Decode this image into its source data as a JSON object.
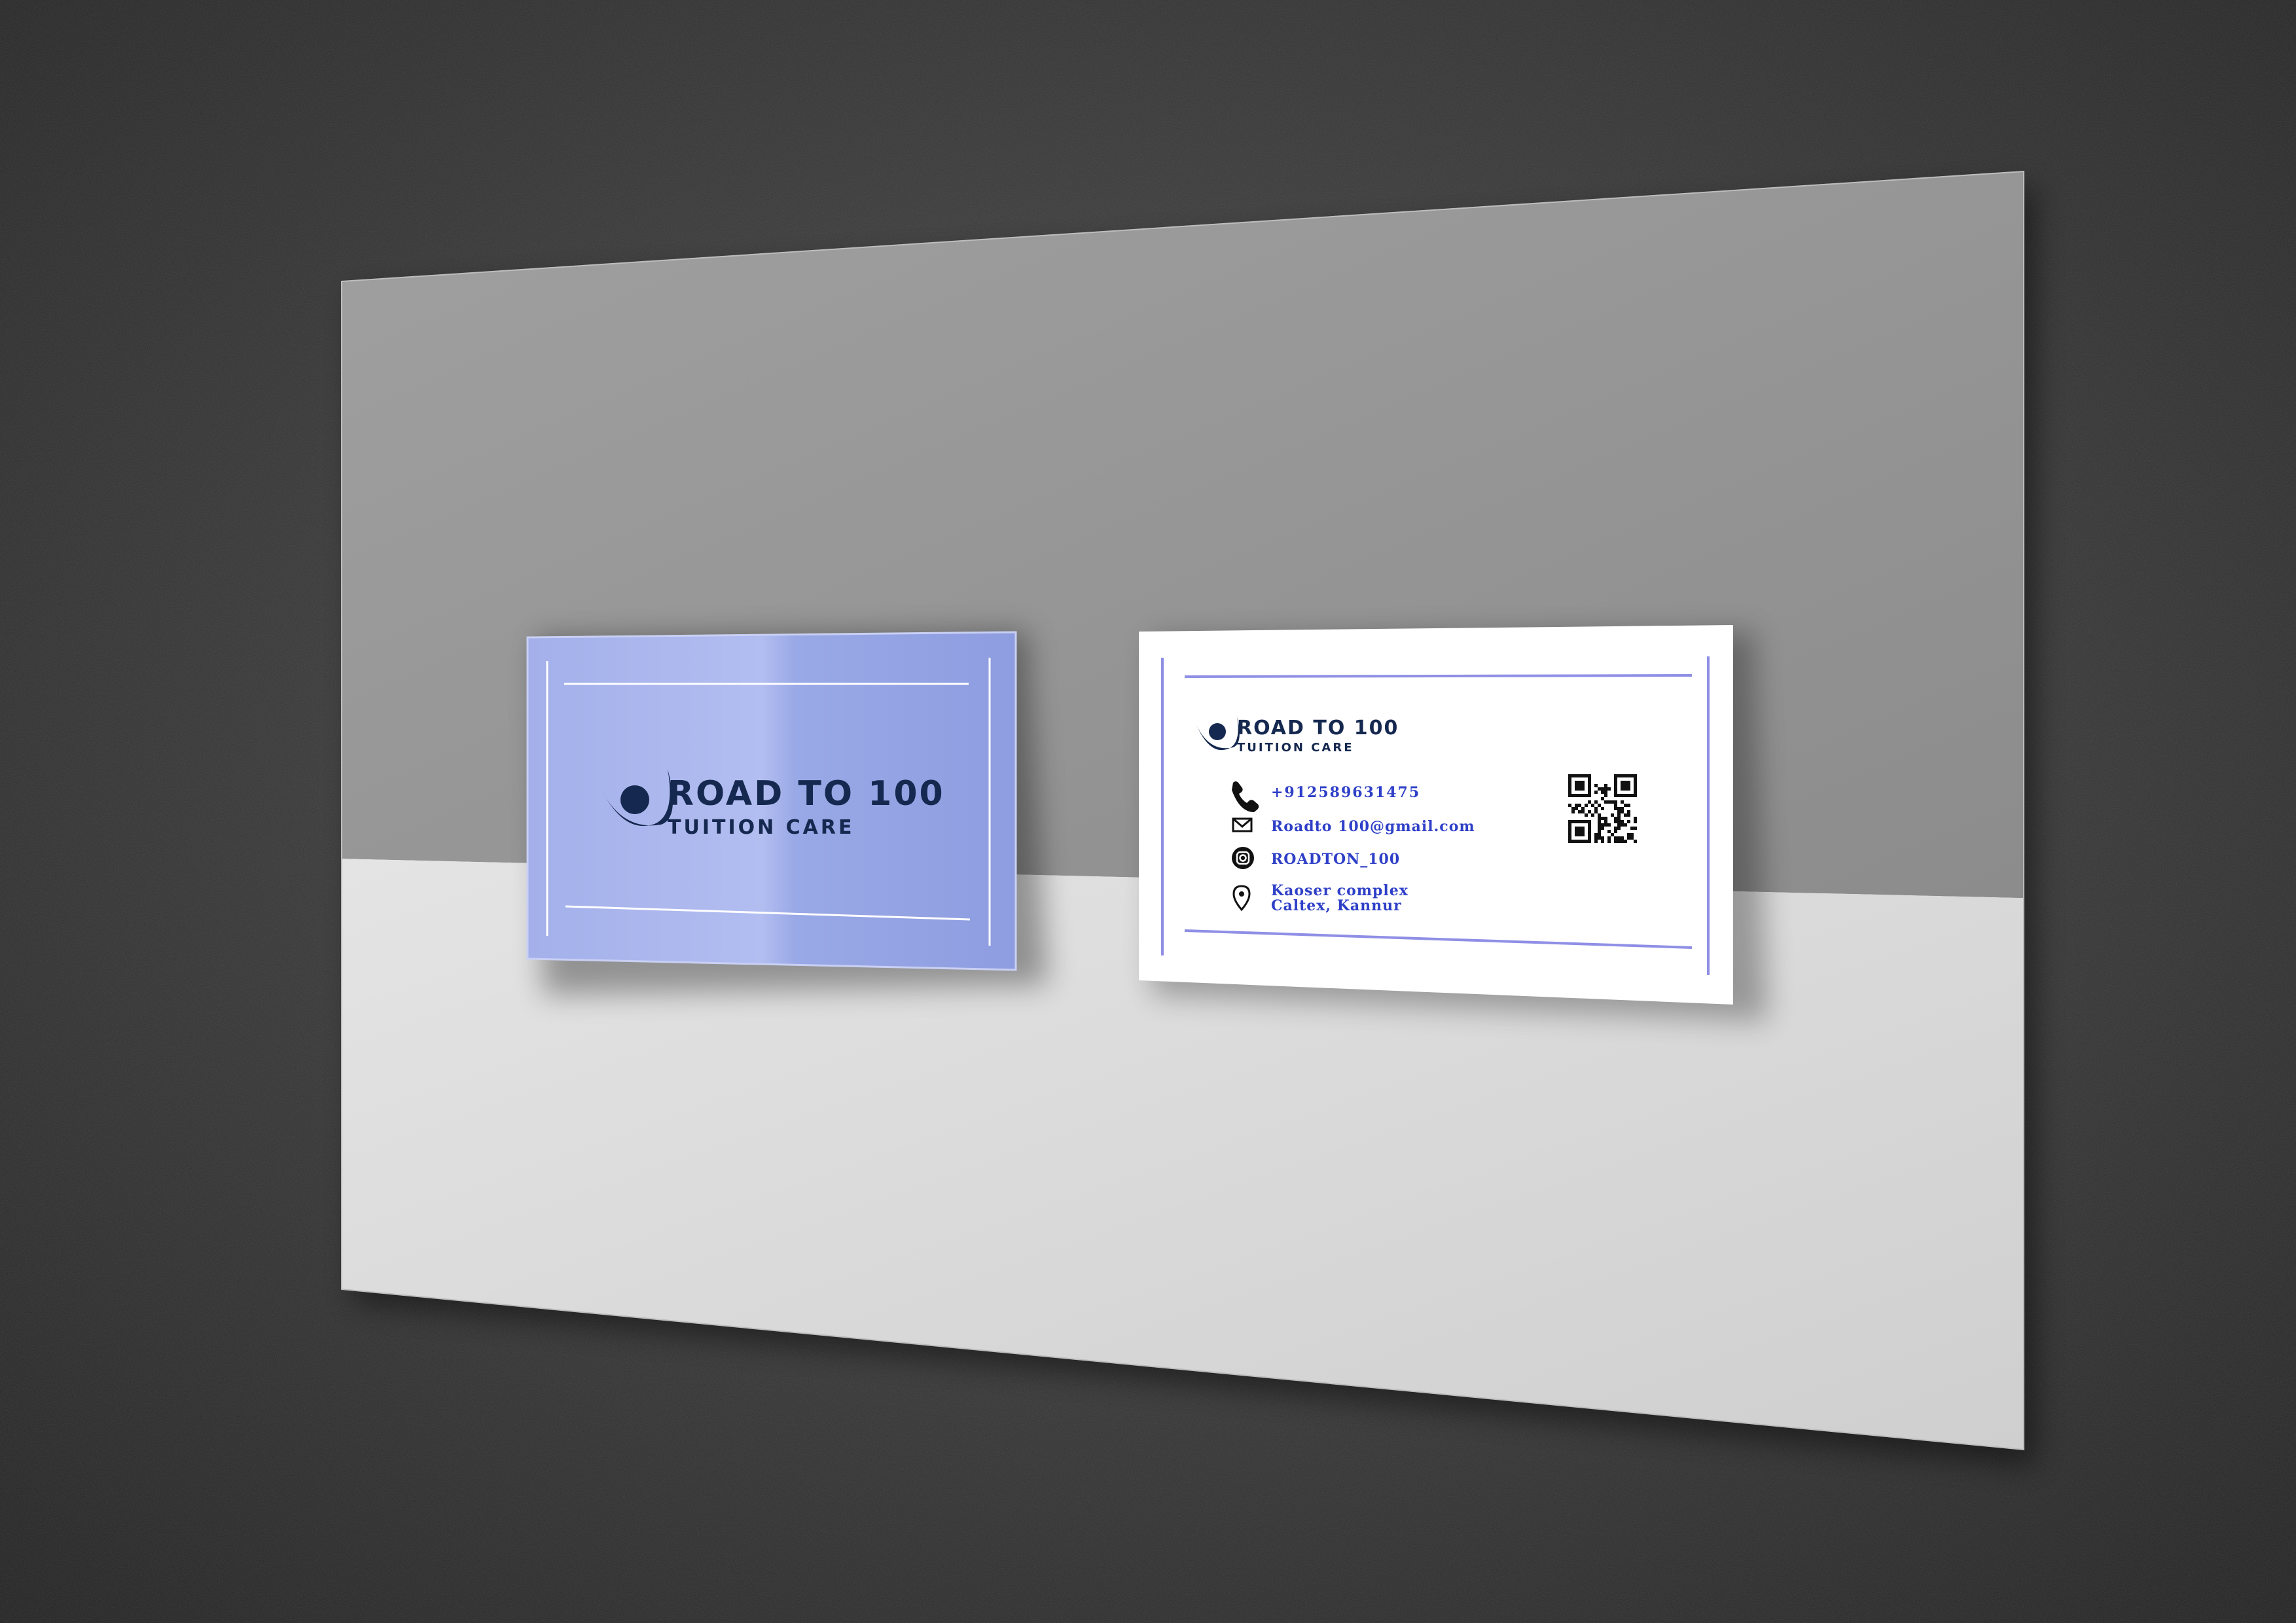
{
  "front_card": {
    "logo_line1": "ROAD TO 100",
    "logo_line2": "TUITION CARE"
  },
  "back_card": {
    "logo_line1": "ROAD TO 100",
    "logo_line2": "TUITION CARE",
    "phone": "+912589631475",
    "email": "Roadto 100@gmail.com",
    "instagram": "ROADTON_100",
    "address_line1": "Kaoser complex",
    "address_line2": "Caltex, Kannur",
    "icons": {
      "phone": "phone-icon",
      "email": "envelope-icon",
      "instagram": "instagram-icon",
      "address": "location-pin-icon",
      "qr": "qr-code"
    }
  },
  "colors": {
    "front_card": "#9aa8e8",
    "brand_navy": "#15284f",
    "contact_text": "#2e3fc8",
    "accent_line": "#8f8fe6"
  }
}
